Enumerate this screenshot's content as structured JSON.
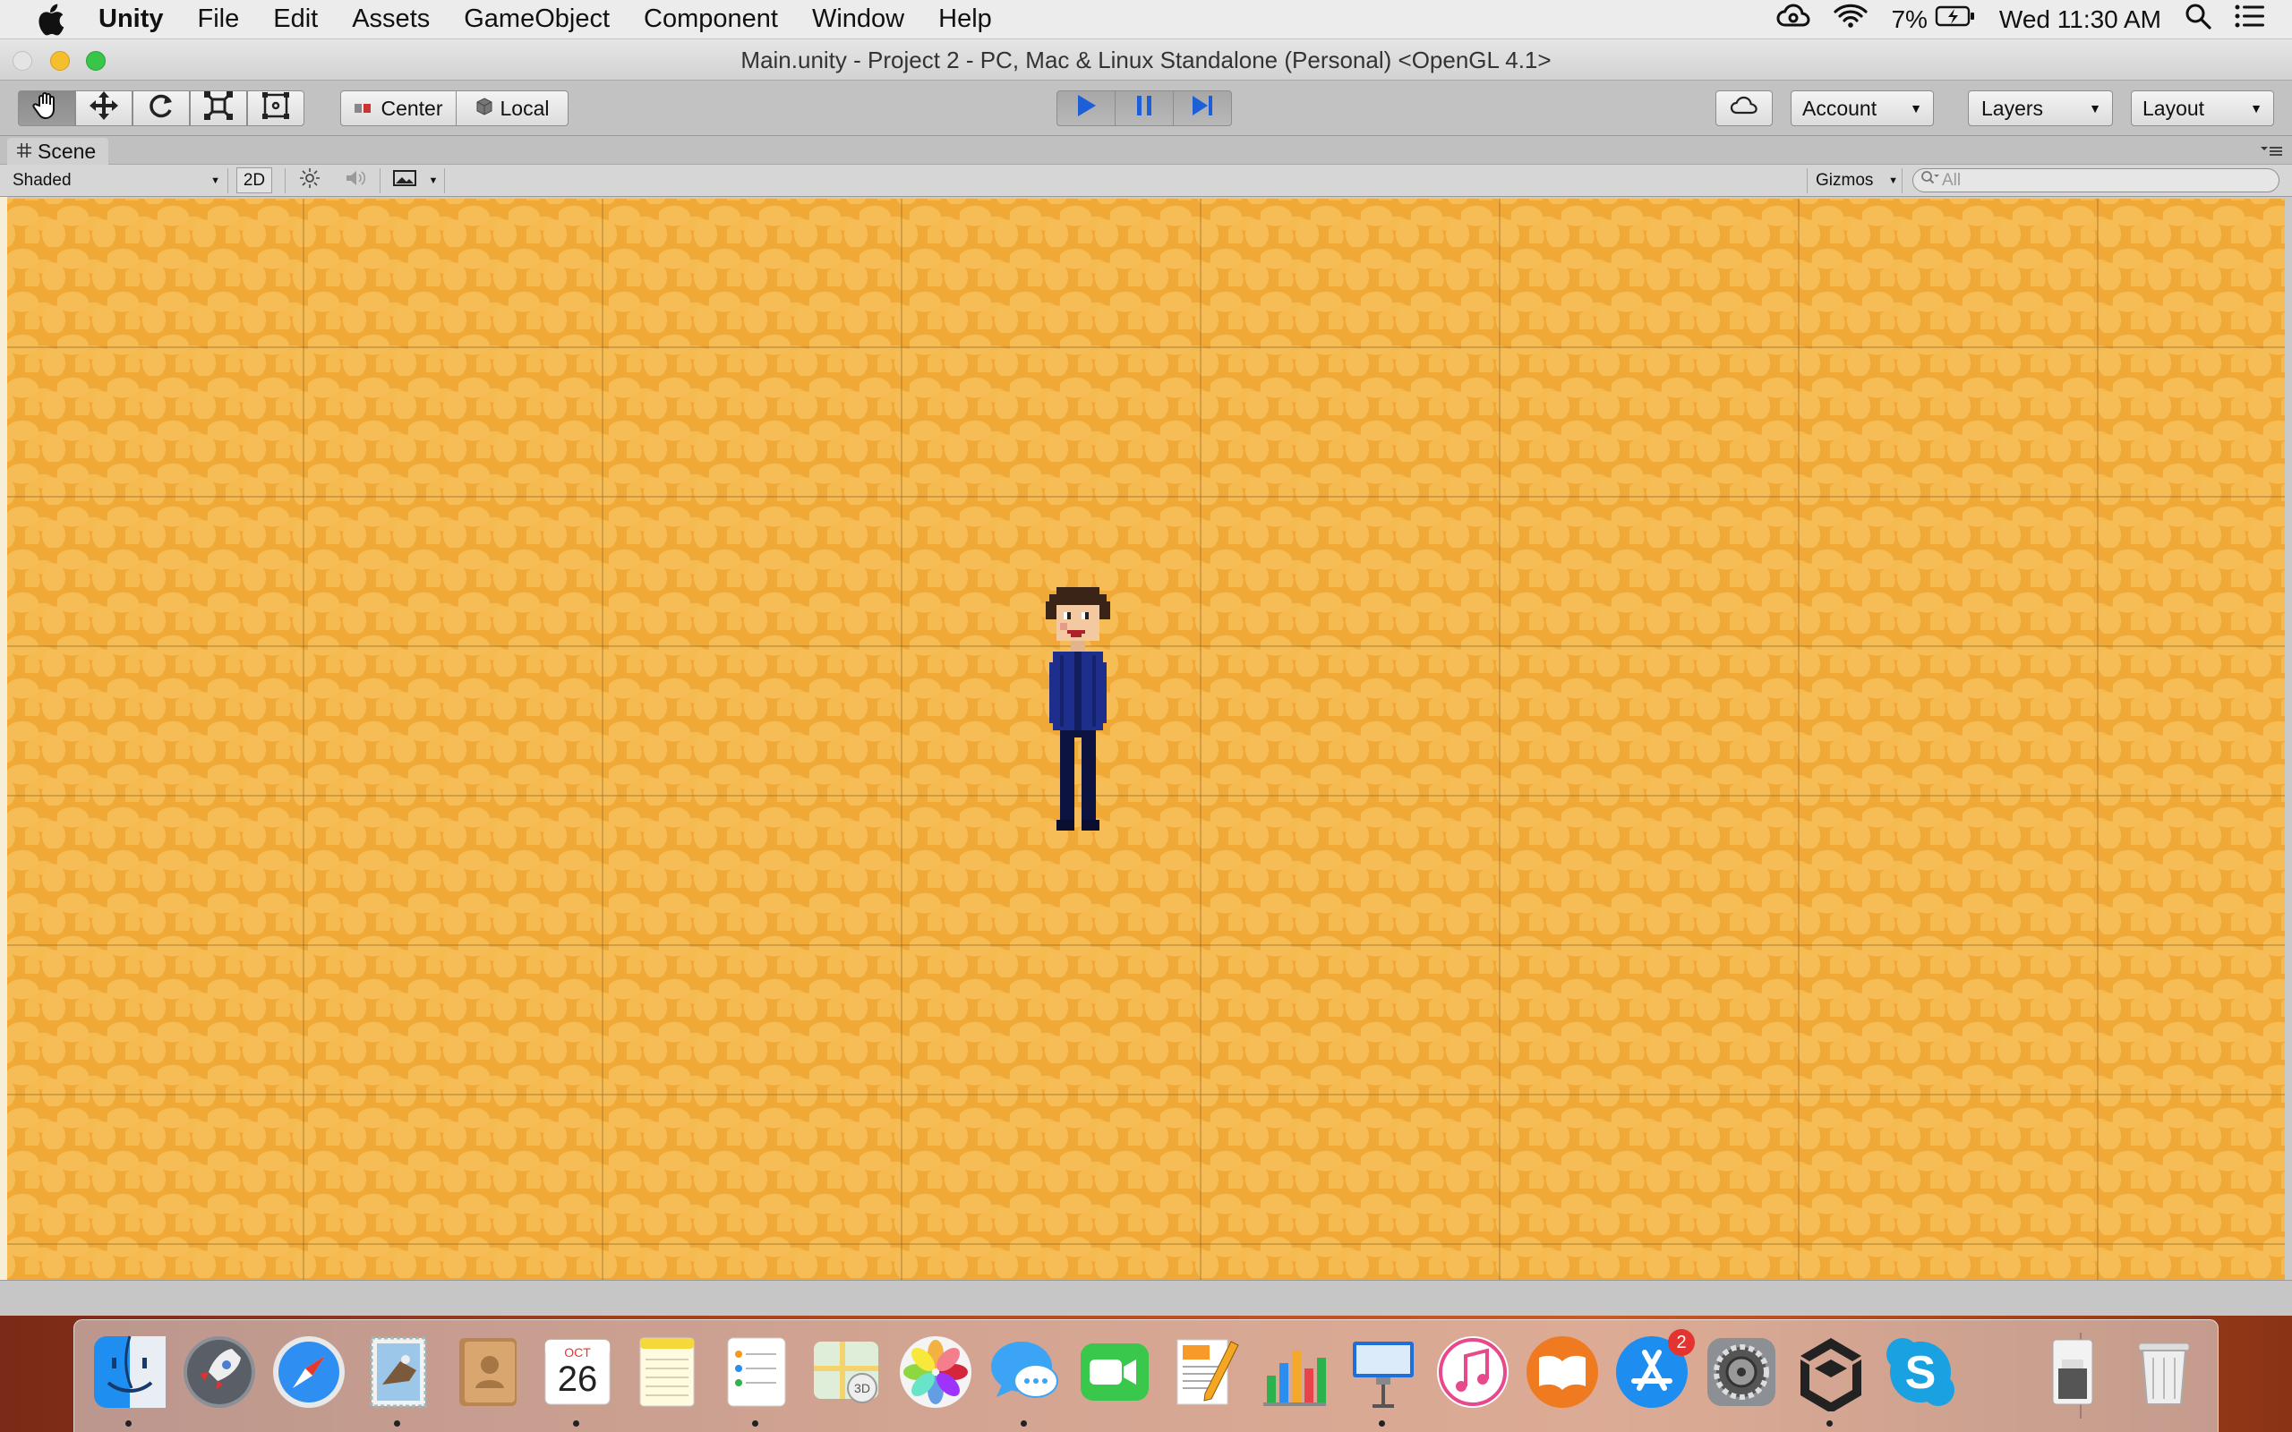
{
  "menubar": {
    "app": "Unity",
    "items": [
      "File",
      "Edit",
      "Assets",
      "GameObject",
      "Component",
      "Window",
      "Help"
    ],
    "battery": "7%",
    "clock": "Wed 11:30 AM"
  },
  "window": {
    "title": "Main.unity - Project 2 - PC, Mac & Linux Standalone (Personal) <OpenGL 4.1>"
  },
  "toolbar": {
    "pivot_label": "Center",
    "space_label": "Local",
    "account_label": "Account",
    "layers_label": "Layers",
    "layout_label": "Layout"
  },
  "scene": {
    "tab_label": "Scene",
    "shading": "Shaded",
    "mode_2d": "2D",
    "gizmos_label": "Gizmos",
    "search_placeholder": "All"
  },
  "dock": {
    "items": [
      "Finder",
      "Launchpad",
      "Safari",
      "Mail",
      "Contacts",
      "Calendar",
      "Notes",
      "Reminders",
      "Maps",
      "Photos",
      "Messages",
      "FaceTime",
      "Pages",
      "Numbers",
      "Keynote",
      "iTunes",
      "iBooks",
      "App Store",
      "System Preferences",
      "Unity",
      "Skype",
      "Downloads",
      "Trash"
    ],
    "calendar_month": "OCT",
    "calendar_day": "26",
    "appstore_badge": "2"
  },
  "colors": {
    "scene_bg": "#f0a936",
    "play_blue": "#1d5fd6"
  }
}
